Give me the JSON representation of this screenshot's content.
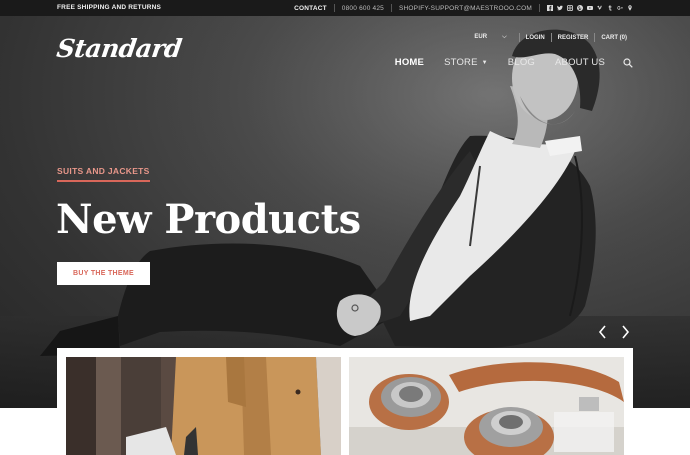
{
  "topbar": {
    "left_text": "FREE SHIPPING AND RETURNS",
    "contact": "CONTACT",
    "phone": "0800 600 425",
    "email": "SHOPIFY-SUPPORT@MAESTROOO.COM",
    "social": [
      "facebook-icon",
      "twitter-icon",
      "instagram-icon",
      "pinterest-icon",
      "youtube-icon",
      "vimeo-icon",
      "tumblr-icon",
      "googleplus-icon",
      "location-icon"
    ]
  },
  "brand": {
    "logo_text": "Standard"
  },
  "util_nav": {
    "currency": "EUR",
    "login": "LOGIN",
    "register": "REGISTER",
    "cart": "CART (0)"
  },
  "main_nav": {
    "items": [
      "HOME",
      "STORE",
      "BLOG",
      "ABOUT US"
    ],
    "active": "HOME"
  },
  "hero": {
    "kicker": "SUITS AND JACKETS",
    "headline": "New Products",
    "cta": "BUY THE THEME",
    "accent_color": "#d9675a"
  },
  "products": [
    {
      "name": "tan-coat-product"
    },
    {
      "name": "headphones-product"
    }
  ]
}
